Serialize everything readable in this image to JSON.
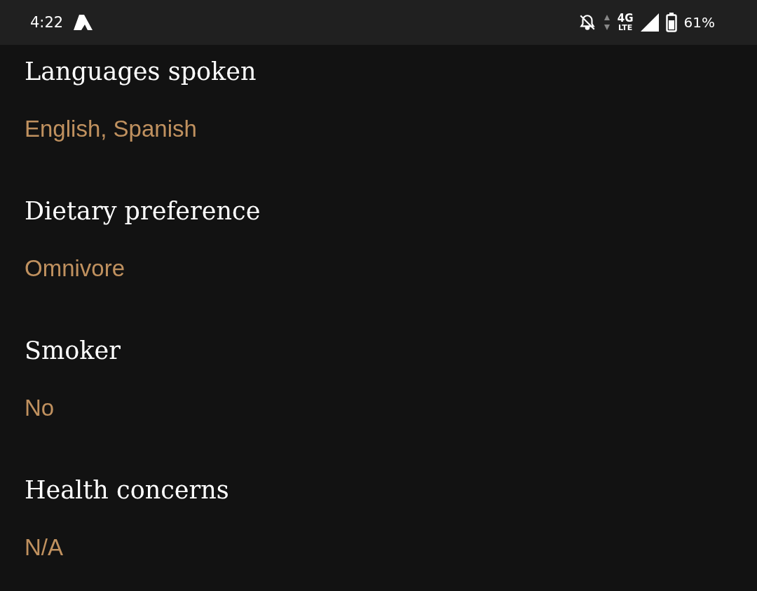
{
  "status_bar": {
    "time": "4:22",
    "network_type": "4G",
    "network_sub": "LTE",
    "battery": "61%"
  },
  "fields": [
    {
      "label": "Languages spoken",
      "value": "English, Spanish"
    },
    {
      "label": "Dietary preference",
      "value": "Omnivore"
    },
    {
      "label": "Smoker",
      "value": "No"
    },
    {
      "label": "Health concerns",
      "value": "N/A"
    }
  ]
}
